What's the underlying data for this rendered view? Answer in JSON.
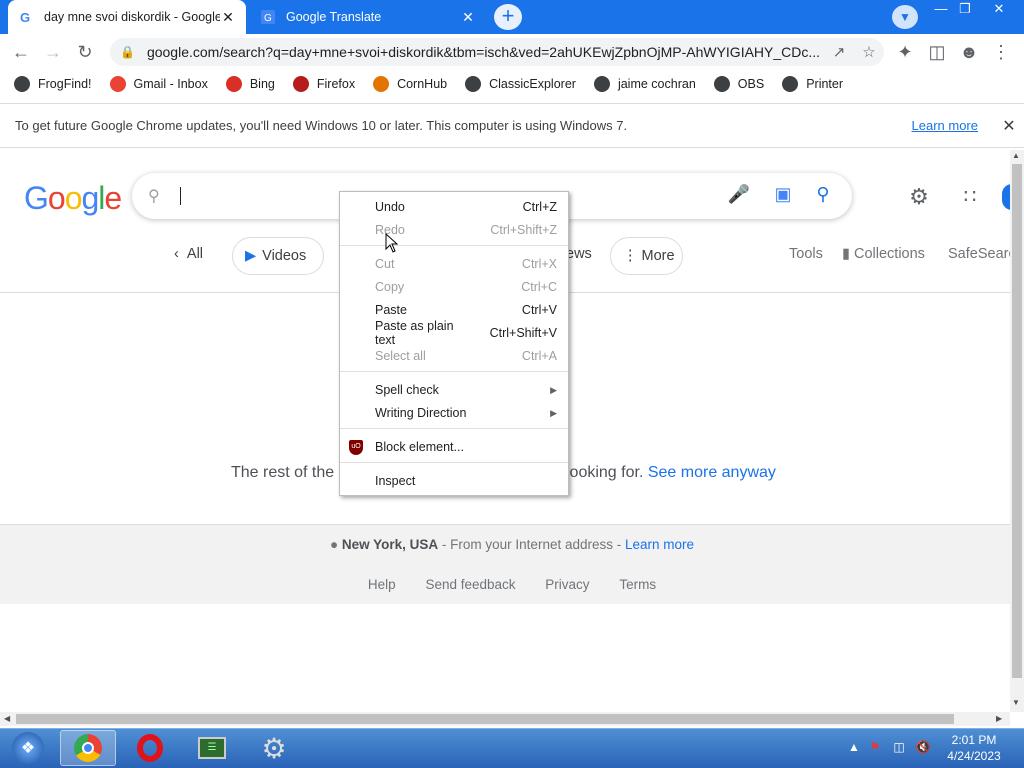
{
  "tabs": [
    {
      "title": "day mne svoi diskordik - Google",
      "close": "✕"
    },
    {
      "title": "Google Translate",
      "close": "✕"
    }
  ],
  "new_tab": "+",
  "window_controls": {
    "minimize": "—",
    "restore": "❐",
    "close": "✕"
  },
  "omnibox": {
    "url": "google.com/search?q=day+mne+svoi+diskordik&tbm=isch&ved=2ahUKEwjZpbnOjMP-AhWYIGIAHY_CDc..."
  },
  "bookmarks": [
    {
      "label": "FrogFind!",
      "icon": "globe-icon",
      "color": "#3c4043"
    },
    {
      "label": "Gmail - Inbox",
      "icon": "gmail-icon",
      "color": "#ea4335"
    },
    {
      "label": "Bing",
      "icon": "sky-icon",
      "color": "#d93025"
    },
    {
      "label": "Firefox",
      "icon": "firefox-icon",
      "color": "#b71c1c"
    },
    {
      "label": "CornHub",
      "icon": "ch-icon",
      "color": "#e37400"
    },
    {
      "label": "ClassicExplorer",
      "icon": "globe-icon",
      "color": "#3c4043"
    },
    {
      "label": "jaime cochran",
      "icon": "globe-icon",
      "color": "#3c4043"
    },
    {
      "label": "OBS",
      "icon": "globe-icon",
      "color": "#3c4043"
    },
    {
      "label": "Printer",
      "icon": "cups-icon",
      "color": "#3c4043"
    }
  ],
  "infobar": {
    "message": "To get future Google Chrome updates, you'll need Windows 10 or later. This computer is using Windows 7.",
    "learn_more": "Learn more"
  },
  "google": {
    "logo": "Google",
    "chips": {
      "all": "All",
      "videos": "Videos",
      "news": "ews",
      "more": "More"
    },
    "tools": "Tools",
    "collections": "Collections",
    "safesearch": "SafeSearc"
  },
  "results": {
    "rest_prefix": "The rest of the",
    "rest_suffix": "looking for.",
    "see_more": "See more anyway"
  },
  "footer": {
    "location": "New York, USA",
    "from": " - From your Internet address - ",
    "learn_more": "Learn more",
    "links": [
      "Help",
      "Send feedback",
      "Privacy",
      "Terms"
    ]
  },
  "context_menu": {
    "items": [
      {
        "label": "Undo",
        "shortcut": "Ctrl+Z",
        "disabled": false
      },
      {
        "label": "Redo",
        "shortcut": "Ctrl+Shift+Z",
        "disabled": true
      },
      {
        "label": "Cut",
        "shortcut": "Ctrl+X",
        "disabled": true
      },
      {
        "label": "Copy",
        "shortcut": "Ctrl+C",
        "disabled": true
      },
      {
        "label": "Paste",
        "shortcut": "Ctrl+V",
        "disabled": false
      },
      {
        "label": "Paste as plain text",
        "shortcut": "Ctrl+Shift+V",
        "disabled": false
      },
      {
        "label": "Select all",
        "shortcut": "Ctrl+A",
        "disabled": true
      },
      {
        "label": "Spell check",
        "shortcut": "",
        "disabled": false
      },
      {
        "label": "Writing Direction",
        "shortcut": "",
        "disabled": false
      },
      {
        "label": "Block element...",
        "shortcut": "",
        "disabled": false
      },
      {
        "label": "Inspect",
        "shortcut": "",
        "disabled": false
      }
    ]
  },
  "taskbar": {
    "time": "2:01 PM",
    "date": "4/24/2023"
  }
}
